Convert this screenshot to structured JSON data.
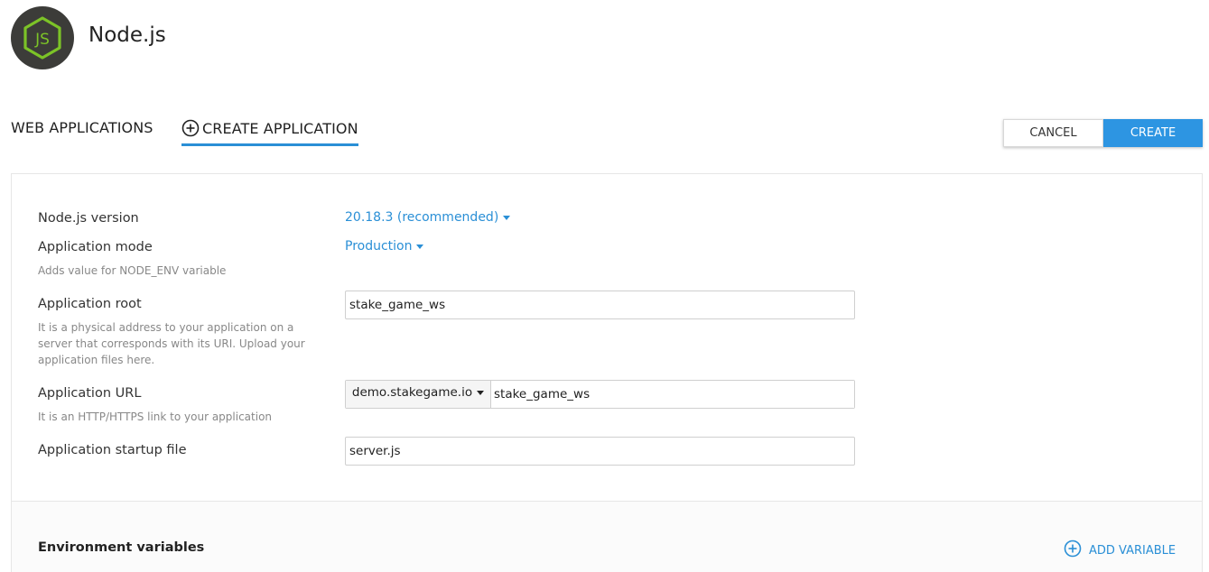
{
  "header": {
    "title": "Node.js",
    "logo_icon": "nodejs-logo-icon"
  },
  "tabs": [
    {
      "label": "WEB APPLICATIONS",
      "active": false
    },
    {
      "label": "CREATE APPLICATION",
      "active": true,
      "icon": "plus-circle-icon"
    }
  ],
  "actions": {
    "cancel_label": "CANCEL",
    "create_label": "CREATE"
  },
  "form": {
    "version": {
      "label": "Node.js version",
      "value": "20.18.3 (recommended)"
    },
    "mode": {
      "label": "Application mode",
      "value": "Production",
      "hint": "Adds value for NODE_ENV variable"
    },
    "root": {
      "label": "Application root",
      "value": "stake_game_ws",
      "hint": "It is a physical address to your application on a server that corresponds with its URI. Upload your application files here."
    },
    "url": {
      "label": "Application URL",
      "domain": "demo.stakegame.io",
      "path": "stake_game_ws",
      "hint": "It is an HTTP/HTTPS link to your application"
    },
    "startup": {
      "label": "Application startup file",
      "value": "server.js"
    }
  },
  "env": {
    "title": "Environment variables",
    "add_label": "ADD VARIABLE",
    "add_icon": "plus-circle-icon"
  },
  "colors": {
    "accent": "#2d95e2",
    "link": "#2a8fd6",
    "logo_bg": "#3c3c39",
    "logo_green": "#7cc327"
  }
}
